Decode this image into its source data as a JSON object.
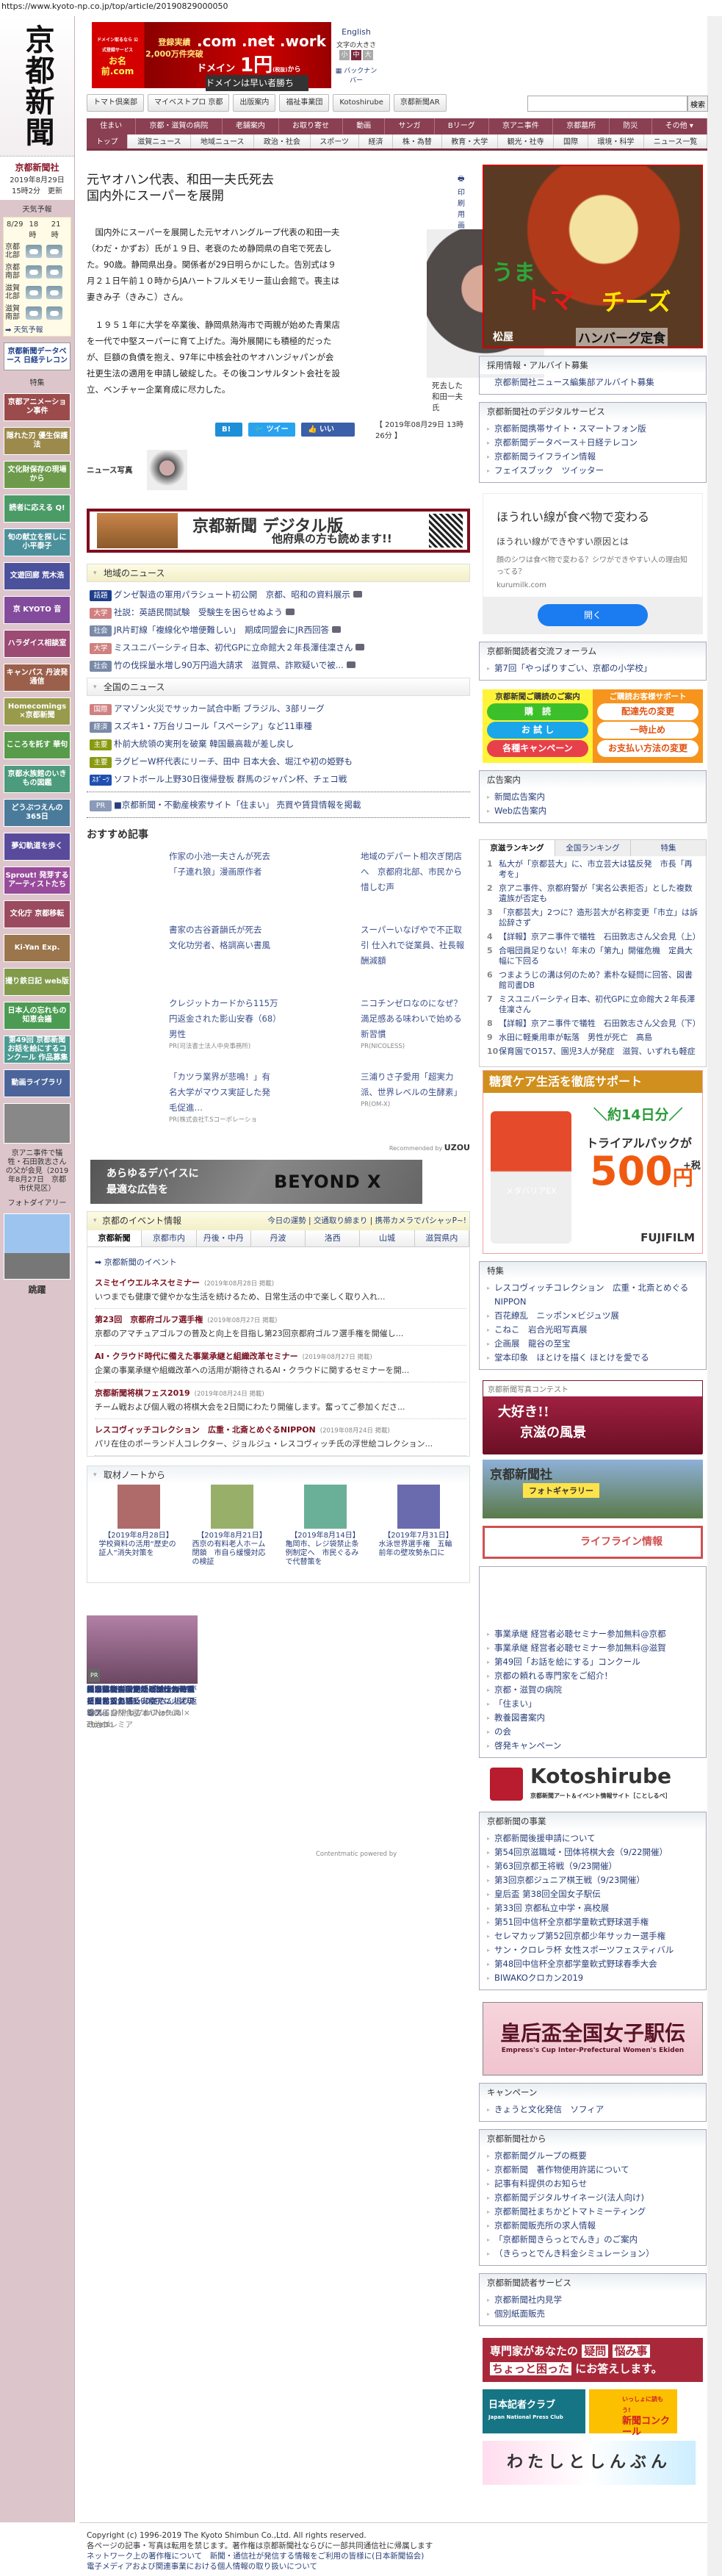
{
  "browser": {
    "url": "https://www.kyoto-np.co.jp/top/article/20190829000050"
  },
  "header": {
    "logo": "京都新聞",
    "ad": {
      "brand_small": "ドメイン取るなら 公式登録サービス",
      "brand": "お名前.com",
      "line1": "登録実績",
      "line2": "2,000万件突破",
      "main": ".com .net .work",
      "domain": "ドメイン",
      "price": "1円",
      "tax": "(税抜)",
      "from": "から",
      "sub": "ドメインは早い者勝ち"
    },
    "english": "English",
    "font_size_label": "文字の大きさ",
    "font_sizes": [
      "小",
      "中",
      "大"
    ],
    "backnumber": "バックナンバー",
    "tool_buttons": [
      "トマト倶楽部",
      "マイベストプロ 京都",
      "出版案内",
      "福祉事業団",
      "Kotoshirube",
      "京都新聞AR"
    ],
    "search_button": "検索",
    "nav_primary": [
      "住まい",
      "京都・滋賀の病院",
      "老舗案内",
      "お取り寄せ",
      "動画",
      "サンガ",
      "Bリーグ",
      "京アニ事件",
      "京都墓所",
      "防災",
      "その他 ▾"
    ],
    "nav_secondary": [
      "トップ",
      "滋賀ニュース",
      "地域ニュース",
      "政治・社会",
      "スポーツ",
      "経済",
      "株・為替",
      "教育・大学",
      "観光・社寺",
      "国際",
      "環境・科学",
      "ニュース一覧"
    ]
  },
  "sidebar": {
    "company": "京都新聞社",
    "updated_date": "2019年8月29日",
    "updated_time": "15時2分　更新",
    "weather": {
      "title": "天気予報",
      "date": "8/29",
      "times": [
        "18時",
        "21時"
      ],
      "regions": [
        "京都北部",
        "京都南部",
        "滋賀北部",
        "滋賀南部"
      ],
      "link": "天気予報"
    },
    "database_banner": "京都新聞データベース 日経テレコン",
    "special_label": "特集",
    "banners": [
      "京都アニメーション事件",
      "隠れた刃 優生保護法",
      "文化財保存の現場から",
      "読者に応える Q!",
      "旬の献立を探しに 小平泰子",
      "文遊回廊 荒木浩",
      "京 KYOTO 音",
      "ハラダイス相談室",
      "キャンパス 丹波発 通信",
      "Homecomings ×京都新聞",
      "こころを託す 華句",
      "京都水族館のいきもの図鑑",
      "どうぶつえんの365日",
      "夢幻軌道を歩く",
      "Sprout! 発芽するアーティストたち",
      "文化庁 京都移転",
      "Ki-Yan Exp.",
      "撮り鉄日記 web版",
      "日本人の忘れもの 知恵会議",
      "第49回 京都新聞 お話を絵にするコンクール 作品募集",
      "動画ライブラリ"
    ],
    "video_caption": "京アニ事件で犠牲・石田敦志さんの父が会見（2019年8月27日　京都市伏見区）",
    "photo_diary_label": "フォトダイアリー",
    "photo_diary_caption": "跳躍"
  },
  "article": {
    "title_line1": "元ヤオハン代表、和田一夫氏死去",
    "title_line2": "国内外にスーパーを展開",
    "print": "印刷用画面を開く",
    "paragraphs": [
      "国内外にスーパーを展開した元ヤオハングループ代表の和田一夫（わだ・かずお）氏が１９日、老衰のため静岡県の自宅で死去した。90歳。静岡県出身。関係者が29日明らかにした。告別式は９月２１日午前１０時からJAハートフルメモリー韮山会館で。喪主は妻きみ子（きみこ）さん。",
      "１９５１年に大学を卒業後、静岡県熱海市で両親が始めた青果店を一代で中堅スーパーに育て上げた。海外展開にも積極的だったが、巨額の負債を抱え、97年に中核会社のヤオハンジャパンが会社更生法の適用を申請し破綻した。その後コンサルタント会社を設立、ベンチャー企業育成に尽力した。"
    ],
    "photo_caption": "死去した和田一夫氏",
    "share": {
      "hatena": "B! 0",
      "tweet": "ツイート",
      "like": "いいね！ 0"
    },
    "published": "【 2019年08月29日 13時26分 】",
    "news_photo_label": "ニュース写真"
  },
  "digital_banner": {
    "title": "京都新聞 デジタル版",
    "subtitle": "他府県の方も読めます!!"
  },
  "regional_news": {
    "title": "地域のニュース",
    "items": [
      {
        "tag": "話題",
        "color": "#1f3f8a",
        "text": "グンゼ製造の軍用パラシュート初公開　京都、昭和の資料展示"
      },
      {
        "tag": "大学",
        "color": "#d08080",
        "text": "社説：英語民間試験　受験生を困らせぬよう"
      },
      {
        "tag": "社会",
        "color": "#7a8aa8",
        "text": "JR片町線「複線化や増便難しい」　期成同盟会にJR西回答"
      },
      {
        "tag": "大学",
        "color": "#d08080",
        "text": "ミスユニバーシティ日本、初代GPに立命館大２年長澤佳凜さん"
      },
      {
        "tag": "社会",
        "color": "#7a8aa8",
        "text": "竹の伐採量水増し90万円過大請求　滋賀県、詐欺疑いで被..."
      }
    ]
  },
  "national_news": {
    "title": "全国のニュース",
    "items": [
      {
        "tag": "国際",
        "color": "#d08080",
        "text": "アマゾン火災でサッカー試合中断 ブラジル、3部リーグ"
      },
      {
        "tag": "経済",
        "color": "#7a8aa8",
        "text": "スズキ1・7万台リコール「スペーシア」など11車種"
      },
      {
        "tag": "主要",
        "color": "#8a9a10",
        "text": "朴前大統領の実刑を破棄 韓国最高裁が差し戻し"
      },
      {
        "tag": "主要",
        "color": "#8a9a10",
        "text": "ラグビーW杯代表にリーチ、田中 日本大会、堀江や初の姫野も"
      },
      {
        "tag": "ｽﾎﾟｰﾂ",
        "color": "#1f4fb0",
        "text": "ソフトボール上野30日復帰登板 群馬のジャパン杯、チェコ戦"
      }
    ]
  },
  "pr_line": {
    "tag": "PR",
    "text": "■京都新聞・不動産検索サイト「住まい」 売買や賃貸情報を掲載"
  },
  "recommended": {
    "title": "おすすめ記事",
    "items": [
      {
        "text": "作家の小池一夫さんが死去「子連れ狼」漫画原作者",
        "source": ""
      },
      {
        "text": "地域のデパート相次ぎ閉店へ　京都府北部、市民から惜しむ声",
        "source": ""
      },
      {
        "text": "書家の古谷蒼韻氏が死去　文化功労者、格調高い書風",
        "source": ""
      },
      {
        "text": "スーパーいなげやで不正取引 仕入れで従業員、社長報酬減額",
        "source": ""
      },
      {
        "text": "クレジットカードから115万円返金された影山安春（68）男性",
        "source": "PR(司法書士法人中央事務所)"
      },
      {
        "text": "ニコチンゼロなのになぜ？満足感ある味わいで始める新習慣",
        "source": "PR(NICOLESS)"
      },
      {
        "text": "「カツラ業界が悲鳴！」有名大学がマウス実証した発毛促進…",
        "source": "PR(株式会社T.Sコーポレーショ"
      },
      {
        "text": "三浦りさ子愛用「超実力派、世界レベルの生酵素」",
        "source": "PR(OM-X)"
      }
    ],
    "recommended_by": "Recommended by",
    "recommended_brand": "UZOU"
  },
  "beyond_ad": {
    "line1": "あらゆるデバイスに",
    "line2": "最適な広告を",
    "brand": "BEYOND X"
  },
  "events": {
    "title": "京都のイベント情報",
    "links": [
      "今日の運勢",
      "交通取り締まり",
      "携帯カメラでパシャッP~!"
    ],
    "tabs": [
      "京都新聞",
      "京都市内",
      "丹後・中丹",
      "丹波",
      "洛西",
      "山城",
      "滋賀県内"
    ],
    "subhead": "京都新聞のイベント",
    "items": [
      {
        "name": "スミセイウエルネスセミナー",
        "date": "(2019年08月28日 掲載)",
        "desc": "いつまでも健康で健やかな生活を続けるため、日常生活の中で楽しく取り入れ..."
      },
      {
        "name": "第23回　京都府ゴルフ選手権",
        "date": "(2019年08月27日 掲載)",
        "desc": "京都のアマチュアゴルフの普及と向上を目指し第23回京都府ゴルフ選手権を開催し..."
      },
      {
        "name": "AI・クラウド時代に備えた事業承継と組織改革セミナー",
        "date": "(2019年08月27日 掲載)",
        "desc": "企業の事業承継や組織改革への活用が期待されるAI・クラウドに関するセミナーを開..."
      },
      {
        "name": "京都新聞将棋フェス2019",
        "date": "(2019年08月24日 掲載)",
        "desc": "チーム戦および個人戦の将棋大会を2日間にわたり開催します。奮ってご参加くださ..."
      },
      {
        "name": "レスコヴィッチコレクション　広重・北斎とめぐるNIPPON",
        "date": "(2019年08月24日 掲載)",
        "desc": "パリ在住のポーランド人コレクター、ジョルジュ・レスコヴィッチ氏の浮世絵コレクション..."
      }
    ]
  },
  "notes": {
    "title": "取材ノートから",
    "items": [
      {
        "date": "【2019年8月28日】",
        "text": "学校資料の活用“歴史の証人”消失対策を"
      },
      {
        "date": "【2019年8月21日】",
        "text": "西京の有料老人ホーム閉鎖　市自ら緩慢対応の検証"
      },
      {
        "date": "【2019年8月14日】",
        "text": "亀岡市、レジ袋禁止条例制定へ　市民ぐるみで代替策を"
      },
      {
        "date": "【2019年7月31日】",
        "text": "水泳世界選手権　五輪前年の壁攻勢糸口に"
      }
    ]
  },
  "photo_news": [
    {
      "text": "「2階の窓開かず」救出された社員、父に語る　京アニ火災現場",
      "source": "",
      "pr": ""
    },
    {
      "text": "県立高校内で同僚と性行為　職員を懲戒免職",
      "source": "",
      "pr": ""
    },
    {
      "text": "梅原猛さん最期「ぱあっと花咲いたよう」 妻・ふささん振り返る",
      "source": "",
      "pr": ""
    },
    {
      "text": "知人の女子大生…疑い、無職…",
      "source": "",
      "pr": ""
    },
    {
      "text": "資源輸入大国、ニッポンの海運を支える力",
      "source": "MOVE ON! by オリックス",
      "pr": "PR"
    },
    {
      "text": "美味しいおみそ汁10食セットが初回特別価格1,000円",
      "source": "世田谷自然食品 on Natural Times",
      "pr": "PR"
    },
    {
      "text": "炭水化物が、加齢を加速させてたなんて",
      "source": "リゲイン トリプルフォース × curebo",
      "pr": "PR"
    },
    {
      "text": "輸出規制に反発するソウルの夏「反日」と「反安倍」に｜オアシス…",
      "source": "政治プレミア",
      "pr": "PR"
    }
  ],
  "contentmatic": "Contentmatic powered by",
  "right": {
    "ad_matsuya": {
      "l1": "うま",
      "l2": "トマ",
      "l3": "チーズ",
      "brand": "松屋",
      "product": "ハンバーグ定食"
    },
    "recruit": {
      "title": "採用情報・アルバイト募集",
      "items": [
        "京都新聞社ニュース編集部アルバイト募集"
      ]
    },
    "digital": {
      "title": "京都新聞社のデジタルサービス",
      "items": [
        "京都新聞携帯サイト・スマートフォン版",
        "京都新聞データベース＋日経テレコン",
        "京都新聞ライフライン情報",
        "フェイスブック　ツイッター"
      ]
    },
    "ad_kurumilk": {
      "headline": "ほうれい線が食べ物で変わる",
      "sub": "ほうれい線ができやすい原因とは",
      "desc": "顔のシワは食べ物で変わる？シワができやすい人の理由知ってる？",
      "domain": "kurumilk.com",
      "button": "開く"
    },
    "forum": {
      "title": "京都新聞読者交流フォーラム",
      "items": [
        "第7回「やっぱりすごい、京都の小学校」"
      ]
    },
    "subscribe": {
      "left_title": "京都新聞ご購読のご案内",
      "left": [
        "購　読",
        "お 試 し",
        "各種キャンペーン"
      ],
      "right_title": "ご購読お客様サポート",
      "right": [
        "配達先の変更",
        "一時止め",
        "お支払い方法の変更"
      ]
    },
    "ads_info": {
      "title": "広告案内",
      "items": [
        "新聞広告案内",
        "Web広告案内"
      ]
    },
    "ranking": {
      "tabs": [
        "京滋ランキング",
        "全国ランキング",
        "特集"
      ],
      "items": [
        "私大が「京都芸大」に、市立芸大は猛反発　市長「再考を」",
        "京アニ事件、京都府警が「実名公表拒否」とした複数遺族が否定も",
        "「京都芸大」2つに？造形芸大が名称変更「市立」は訴訟辞さず",
        "【詳報】京アニ事件で犠牲　石田敦志さん父会見（上）",
        "合唱団員足りない！年末の「第九」開催危機　定員大幅に下回る",
        "つまようじの溝は何のため？素朴な疑問に回答、図書館司書DB",
        "ミスユニバーシティ日本、初代GPに立命館大２年長澤佳凜さん",
        "【詳報】京アニ事件で犠牲　石田敦志さん父会見（下）",
        "水田に軽乗用車が転落　男性が死亡　高島",
        "保育園でO157、園児3人が発症　滋賀、いずれも軽症"
      ]
    },
    "ad_fujifilm": {
      "headline": "糖質ケア生活を徹底サポート",
      "product": "メタバリアEX",
      "days": "＼約14日分／",
      "trial": "トライアルパックが",
      "price": "500",
      "yen": "円",
      "tax": "+税",
      "brand": "FUJIFILM"
    },
    "special": {
      "title": "特集",
      "items": [
        "レスコヴィッチコレクション　広重・北斎とめぐるNIPPON",
        "百花繚乱　ニッポン×ビジュツ展",
        "こねこ　岩合光昭写真展",
        "企画展　龍谷の至宝",
        "堂本印象　ほとけを描く ほとけを愛でる"
      ]
    },
    "photo_contest": {
      "title": "京都新聞写真コンテスト",
      "l1": "大好き!!",
      "l2": "京滋の風景"
    },
    "photo_gallery": {
      "brand": "京都新聞社",
      "label": "フォトギャラリー"
    },
    "lifeline": "ライフライン情報",
    "misc": {
      "items": [
        "事業承継 経営者必聴セミナー参加無料@京都",
        "事業承継 経営者必聴セミナー参加無料@滋賀",
        "第49回「お話を絵にする」コンクール",
        "京都の頼れる専門家をご紹介！",
        "京都・滋賀の病院",
        "「住まい」",
        "教養図書案内",
        "の会",
        "啓発キャンペーン"
      ]
    },
    "kotoshirube": {
      "name": "Kotoshirube",
      "sub": "京都新聞アート＆イベント情報サイト［ことしるべ］"
    },
    "business": {
      "title": "京都新聞の事業",
      "items": [
        "京都新聞後援申請について",
        "第54回京滋職域・団体将棋大会（9/22開催）",
        "第63回京都王将戦（9/23開催）",
        "第3回京都ジュニア棋王戦（9/23開催）",
        "皇后盃 第38回全国女子駅伝",
        "第33回 京都私立中学・高校展",
        "第51回中信杯全京都学童軟式野球選手権",
        "セレマカップ第52回京都少年サッカー選手権",
        "サン・クロレラ杯 女性スポーツフェスティバル",
        "第48回中信杯全京都学童軟式野球春季大会",
        "BIWAKOクロカン2019"
      ]
    },
    "empress": {
      "title": "皇后盃全国女子駅伝",
      "sub": "Empress's Cup Inter-Prefectural Women's Ekiden"
    },
    "campaign": {
      "title": "キャンペーン",
      "items": [
        "きょうと文化発信　ソフィア"
      ]
    },
    "from_company": {
      "title": "京都新聞社から",
      "items": [
        "京都新聞グループの概要",
        "京都新聞　著作物使用許諾について",
        "記事有料提供のお知らせ",
        "京都新聞デジタルサイネージ(法人向け)",
        "京都新聞社まちかどトマトミーティング",
        "京都新聞販売所の求人情報",
        "「京都新聞きらっとでんき」のご案内",
        "（きらっとでんき料金シミュレーション）"
      ]
    },
    "reader_service": {
      "title": "京都新聞読者サービス",
      "items": [
        "京都新聞社内見学",
        "個別紙面販売"
      ]
    },
    "expert_banner": {
      "l1": "専門家があなたの",
      "t1": "疑問",
      "t2": "悩み事",
      "t3": "ちょっと困った",
      "l2": "にお答えします。"
    },
    "press_club": {
      "name": "日本記者クラブ",
      "en": "Japan National Press Club"
    },
    "nie": {
      "top": "いっしょに読もう!",
      "name": "新聞コンクール"
    },
    "watashi": "わたしとしんぶん"
  },
  "footer": {
    "copyright": "Copyright (c) 1996-2019 The Kyoto Shimbun Co.,Ltd. All rights reserved.",
    "notice": "各ページの記事・写真は転用を禁じます。著作権は京都新聞社ならびに一部共同通信社に帰属します",
    "links": [
      "ネットワーク上の著作権について",
      "新聞・通信社が発信する情報をご利用の皆様に(日本新聞協会)",
      "電子メディアおよび関連事業における個人情報の取り扱いについて"
    ]
  }
}
